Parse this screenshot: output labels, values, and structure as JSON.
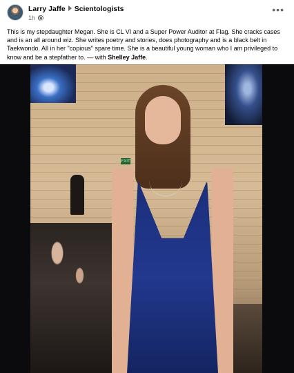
{
  "post": {
    "author": "Larry Jaffe",
    "group": "Scientologists",
    "time": "1h",
    "audience_icon": "globe-icon",
    "more_icon": "more-options-icon",
    "caption_text": "This is my stepdaughter Megan. She is CL VI and a Super Power Auditor at Flag. She cracks cases and is an all around wiz. She writes poetry and stories, does photography and is a black belt in Taekwondo. All in her \"copious\" spare time. She is a beautiful young woman who I am privileged to know and be a stepfather to. — with",
    "tagged_person": "Shelley Jaffe",
    "caption_end": "."
  },
  "photo": {
    "exit_sign": "EXIT"
  }
}
